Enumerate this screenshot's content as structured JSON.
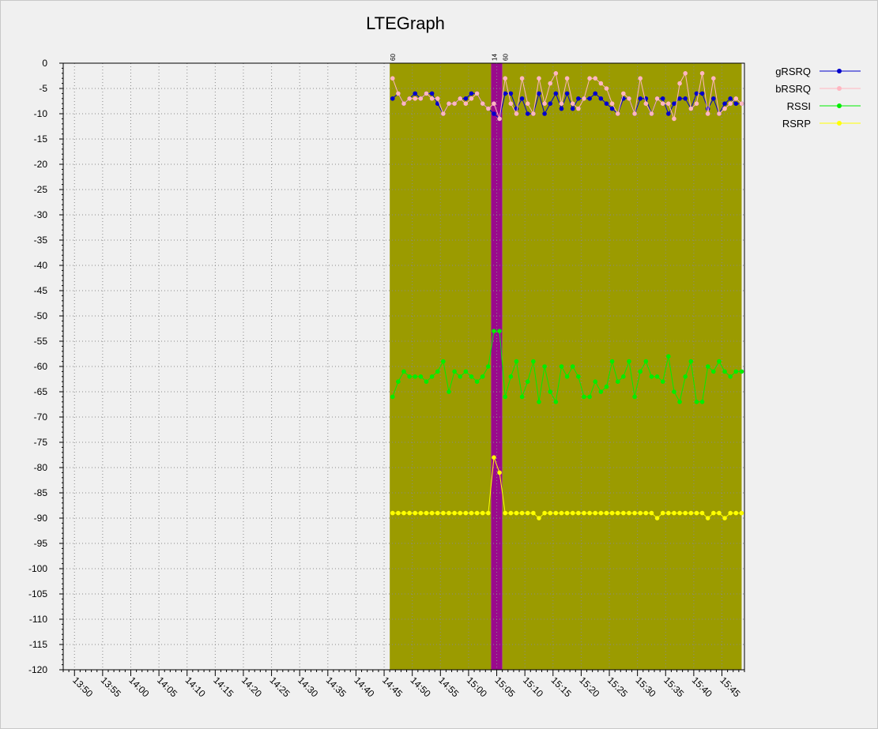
{
  "window": {
    "title": "LTEGraph"
  },
  "chart_data": {
    "type": "line",
    "title": "LTEGraph",
    "xlabel": "",
    "ylabel": "",
    "ylim": [
      -120,
      0
    ],
    "y_ticks": [
      0,
      -5,
      -10,
      -15,
      -20,
      -25,
      -30,
      -35,
      -40,
      -45,
      -50,
      -55,
      -60,
      -65,
      -70,
      -75,
      -80,
      -85,
      -90,
      -95,
      -100,
      -105,
      -110,
      -115,
      -120
    ],
    "x_range": [
      "13:48",
      "15:49"
    ],
    "x_ticks": [
      "13:50",
      "13:55",
      "14:00",
      "14:05",
      "14:10",
      "14:15",
      "14:20",
      "14:25",
      "14:30",
      "14:35",
      "14:40",
      "14:45",
      "14:50",
      "14:55",
      "15:00",
      "15:05",
      "15:10",
      "15:15",
      "15:20",
      "15:25",
      "15:30",
      "15:35",
      "15:40",
      "15:45"
    ],
    "grid": true,
    "legend_position": "top-right",
    "bands": [
      {
        "start": "14:46",
        "end": "15:04",
        "color": "#9b9b00",
        "label": "60"
      },
      {
        "start": "15:04",
        "end": "15:06",
        "color": "#9a0a8c",
        "label": "14"
      },
      {
        "start": "15:06",
        "end": "15:48.5",
        "color": "#9b9b00",
        "label": "60"
      }
    ],
    "x": [
      "14:46.5",
      "14:47.5",
      "14:48.5",
      "14:49.5",
      "14:50.5",
      "14:51.5",
      "14:52.5",
      "14:53.5",
      "14:54.5",
      "14:55.5",
      "14:56.5",
      "14:57.5",
      "14:58.5",
      "14:59.5",
      "15:00.5",
      "15:01.5",
      "15:02.5",
      "15:03.5",
      "15:04.5",
      "15:05.5",
      "15:06.5",
      "15:07.5",
      "15:08.5",
      "15:09.5",
      "15:10.5",
      "15:11.5",
      "15:12.5",
      "15:13.5",
      "15:14.5",
      "15:15.5",
      "15:16.5",
      "15:17.5",
      "15:18.5",
      "15:19.5",
      "15:20.5",
      "15:21.5",
      "15:22.5",
      "15:23.5",
      "15:24.5",
      "15:25.5",
      "15:26.5",
      "15:27.5",
      "15:28.5",
      "15:29.5",
      "15:30.5",
      "15:31.5",
      "15:32.5",
      "15:33.5",
      "15:34.5",
      "15:35.5",
      "15:36.5",
      "15:37.5",
      "15:38.5",
      "15:39.5",
      "15:40.5",
      "15:41.5",
      "15:42.5",
      "15:43.5",
      "15:44.5",
      "15:45.5",
      "15:46.5",
      "15:47.5",
      "15:48.5"
    ],
    "series": [
      {
        "name": "gRSRQ",
        "color": "#0000cc",
        "values": [
          -7,
          -6,
          -8,
          -7,
          -6,
          -7,
          -6,
          -6,
          -8,
          -10,
          -8,
          -8,
          -7,
          -7,
          -6,
          -6,
          -8,
          -9,
          -10,
          -11,
          -6,
          -6,
          -9,
          -7,
          -10,
          -10,
          -6,
          -10,
          -8,
          -6,
          -9,
          -6,
          -9,
          -7,
          -7,
          -7,
          -6,
          -7,
          -8,
          -9,
          -10,
          -7,
          -7,
          -10,
          -7,
          -7,
          -10,
          -7,
          -7,
          -10,
          -8,
          -7,
          -7,
          -9,
          -6,
          -6,
          -9,
          -7,
          -10,
          -8,
          -7,
          -8,
          -8
        ]
      },
      {
        "name": "bRSRQ",
        "color": "#ffb6c1",
        "values": [
          -3,
          -6,
          -8,
          -7,
          -7,
          -7,
          -6,
          -7,
          -7,
          -10,
          -8,
          -8,
          -7,
          -8,
          -7,
          -6,
          -8,
          -9,
          -8,
          -11,
          -3,
          -8,
          -10,
          -3,
          -8,
          -10,
          -3,
          -8,
          -4,
          -2,
          -8,
          -3,
          -8,
          -9,
          -7,
          -3,
          -3,
          -4,
          -5,
          -8,
          -10,
          -6,
          -7,
          -10,
          -3,
          -8,
          -10,
          -7,
          -8,
          -8,
          -11,
          -4,
          -2,
          -9,
          -8,
          -2,
          -10,
          -3,
          -10,
          -9,
          -8,
          -7,
          -8
        ]
      },
      {
        "name": "RSSI",
        "color": "#00ee00",
        "values": [
          -66,
          -63,
          -61,
          -62,
          -62,
          -62,
          -63,
          -62,
          -61,
          -59,
          -65,
          -61,
          -62,
          -61,
          -62,
          -63,
          -62,
          -60,
          -53,
          -53,
          -66,
          -62,
          -59,
          -66,
          -63,
          -59,
          -67,
          -60,
          -65,
          -67,
          -60,
          -62,
          -60,
          -62,
          -66,
          -66,
          -63,
          -65,
          -64,
          -59,
          -63,
          -62,
          -59,
          -66,
          -61,
          -59,
          -62,
          -62,
          -63,
          -58,
          -65,
          -67,
          -62,
          -59,
          -67,
          -67,
          -60,
          -61,
          -59,
          -61,
          -62,
          -61,
          -61
        ]
      },
      {
        "name": "RSRP",
        "color": "#ffff00",
        "values": [
          -89,
          -89,
          -89,
          -89,
          -89,
          -89,
          -89,
          -89,
          -89,
          -89,
          -89,
          -89,
          -89,
          -89,
          -89,
          -89,
          -89,
          -89,
          -78,
          -81,
          -89,
          -89,
          -89,
          -89,
          -89,
          -89,
          -90,
          -89,
          -89,
          -89,
          -89,
          -89,
          -89,
          -89,
          -89,
          -89,
          -89,
          -89,
          -89,
          -89,
          -89,
          -89,
          -89,
          -89,
          -89,
          -89,
          -89,
          -90,
          -89,
          -89,
          -89,
          -89,
          -89,
          -89,
          -89,
          -89,
          -90,
          -89,
          -89,
          -90,
          -89,
          -89,
          -89
        ]
      }
    ]
  }
}
